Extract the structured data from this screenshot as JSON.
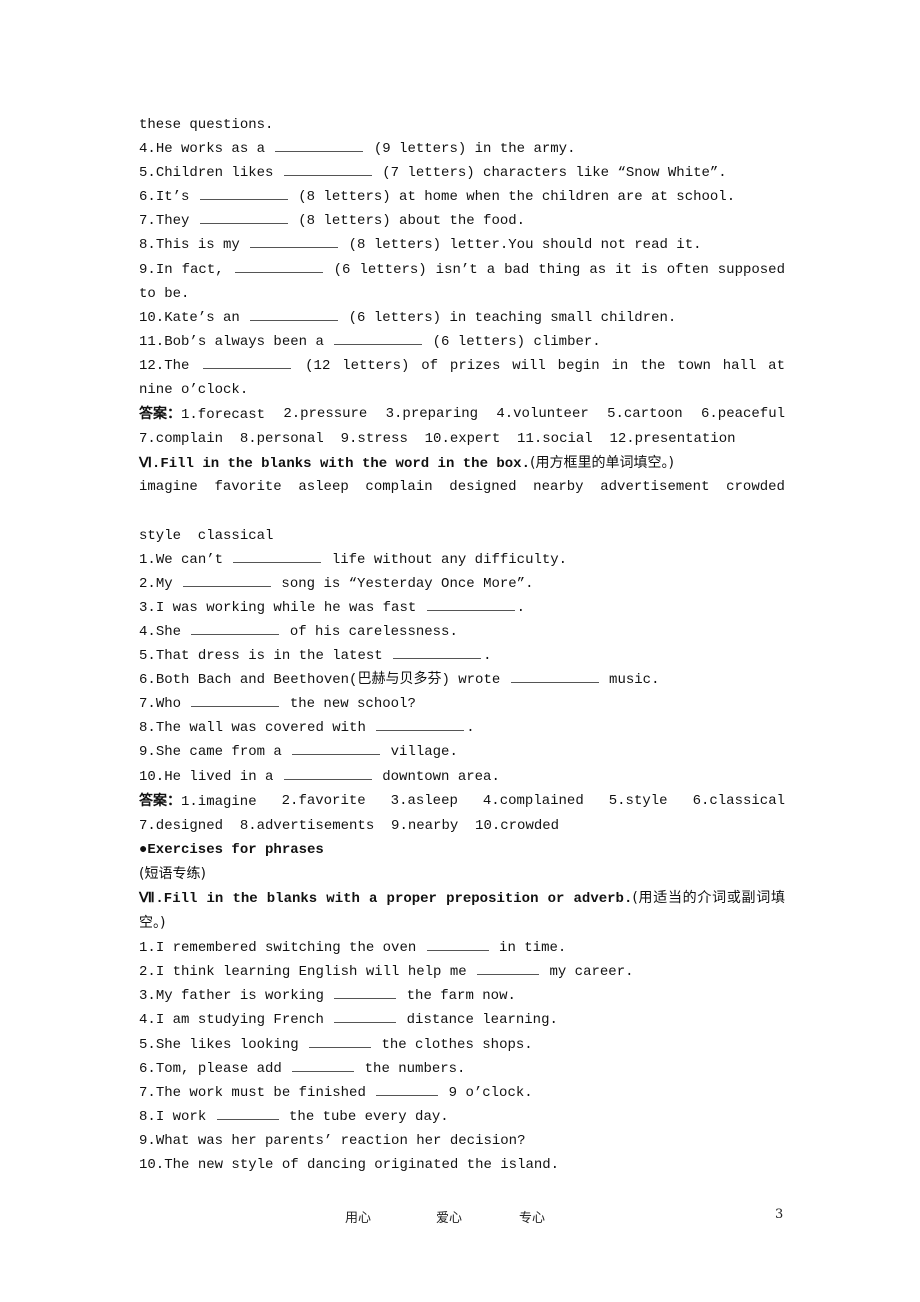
{
  "section_v_tail": {
    "continuation": "these questions.",
    "items": [
      {
        "num": "4.",
        "before": "He works as a ",
        "after": " (9 letters) in the army."
      },
      {
        "num": "5.",
        "before": "Children likes ",
        "after": " (7 letters) characters like “Snow White”."
      },
      {
        "num": "6.",
        "before": "It’s ",
        "after": " (8 letters) at home when the children are at school."
      },
      {
        "num": "7.",
        "before": "They ",
        "after": " (8 letters) about the food."
      },
      {
        "num": "8.",
        "before": "This is my ",
        "after": " (8 letters) letter.You should not read it."
      },
      {
        "num": "9.",
        "before": "In fact, ",
        "after": " (6 letters) isn’t a bad thing as it is often supposed to be."
      },
      {
        "num": "10.",
        "before": "Kate’s an ",
        "after": " (6 letters) in teaching small children."
      },
      {
        "num": "11.",
        "before": "Bob’s always been a ",
        "after": " (6 letters) climber."
      },
      {
        "num": "12.",
        "before": "The ",
        "after": " (12 letters) of prizes will begin in the town hall at nine o’clock."
      }
    ],
    "answer_label": "答案：",
    "answers_line1": [
      "1.forecast",
      "2.pressure",
      "3.preparing",
      "4.volunteer",
      "5.cartoon",
      "6.peaceful"
    ],
    "answers_line2": "7.complain  8.personal  9.stress  10.expert  11.social  12.presentation"
  },
  "section_vi": {
    "heading": "Ⅵ.Fill in the blanks with the word in the box.",
    "heading_cn": "(用方框里的单词填空。)",
    "word_box_line1": [
      "imagine",
      "favorite",
      "asleep",
      "complain",
      "designed",
      "nearby",
      "advertisement",
      "crowded"
    ],
    "word_box_line2": "style  classical",
    "items": [
      {
        "num": "1.",
        "before": "We can’t ",
        "after": " life without any difficulty."
      },
      {
        "num": "2.",
        "before": "My ",
        "after": " song is “Yesterday Once More”."
      },
      {
        "num": "3.",
        "before": "I was working while he was fast ",
        "after": "."
      },
      {
        "num": "4.",
        "before": "She ",
        "after": " of his carelessness."
      },
      {
        "num": "5.",
        "before": "That dress is in the latest ",
        "after": "."
      },
      {
        "num": "6.",
        "before": "Both Bach and Beethoven(巴赫与贝多芬) wrote ",
        "after": " music."
      },
      {
        "num": "7.",
        "before": "Who ",
        "after": " the new school?"
      },
      {
        "num": "8.",
        "before": "The wall was covered with ",
        "after": "."
      },
      {
        "num": "9.",
        "before": "She came from a ",
        "after": " village."
      },
      {
        "num": "10.",
        "before": "He lived in a ",
        "after": " downtown area."
      }
    ],
    "answer_label": "答案：",
    "answers_line1": [
      "1.imagine",
      "2.favorite",
      "3.asleep",
      "4.complained",
      "5.style",
      "6.classical"
    ],
    "answers_line2": "7.designed  8.advertisements  9.nearby  10.crowded"
  },
  "phrases": {
    "heading": "●Exercises for phrases",
    "heading_cn": "(短语专练)"
  },
  "section_vii": {
    "heading": "Ⅶ.Fill in the blanks with a proper preposition or adverb.",
    "heading_cn": "(用适当的介词或副词填空。)",
    "items": [
      {
        "num": "1.",
        "before": "I remembered switching the oven ",
        "after": " in time.",
        "blank": true
      },
      {
        "num": "2.",
        "before": "I think learning English will help me ",
        "after": " my career.",
        "blank": true
      },
      {
        "num": "3.",
        "before": "My father is working ",
        "after": " the farm now.",
        "blank": true
      },
      {
        "num": "4.",
        "before": "I am studying French ",
        "after": " distance learning.",
        "blank": true
      },
      {
        "num": "5.",
        "before": "She likes looking ",
        "after": " the clothes shops.",
        "blank": true
      },
      {
        "num": "6.",
        "before": "Tom, please add ",
        "after": " the numbers.",
        "blank": true
      },
      {
        "num": "7.",
        "before": "The work must be finished ",
        "after": " 9 o’clock.",
        "blank": true
      },
      {
        "num": "8.",
        "before": "I work ",
        "after": " the tube every day.",
        "blank": true
      },
      {
        "num": "9.",
        "before": "What was her parents’ reaction her decision?",
        "after": "",
        "blank": false
      },
      {
        "num": "10.",
        "before": "The new style of dancing originated the island.",
        "after": "",
        "blank": false
      }
    ]
  },
  "footer": {
    "mottos": [
      "用心",
      "爱心",
      "专心"
    ],
    "page_number": "3"
  }
}
